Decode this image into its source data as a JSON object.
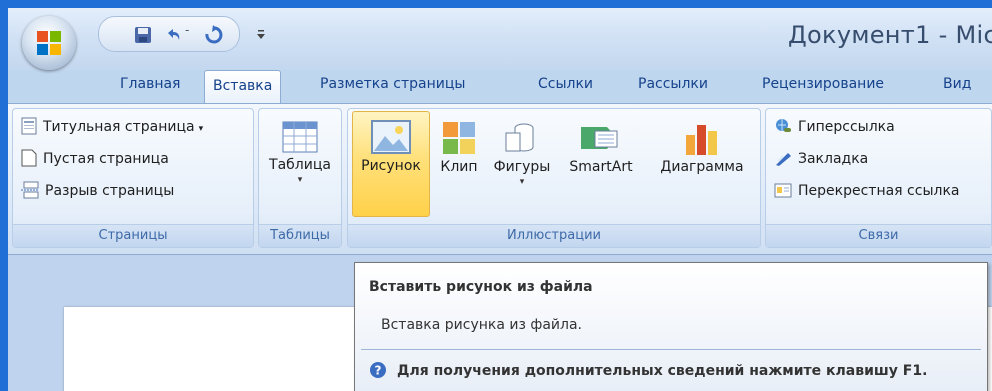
{
  "title_bar": {
    "document_title": "Документ1 - Mic",
    "office_button": "office-button",
    "quick_access": [
      "save-icon",
      "undo-icon",
      "redo-icon"
    ],
    "customize_icon": "customize-qat-icon"
  },
  "tabs": [
    {
      "label": "Главная",
      "active": false
    },
    {
      "label": "Вставка",
      "active": true
    },
    {
      "label": "Разметка страницы",
      "active": false
    },
    {
      "label": "Ссылки",
      "active": false
    },
    {
      "label": "Рассылки",
      "active": false
    },
    {
      "label": "Рецензирование",
      "active": false
    },
    {
      "label": "Вид",
      "active": false
    }
  ],
  "groups": {
    "pages": {
      "label": "Страницы",
      "items": [
        "Титульная страница",
        "Пустая страница",
        "Разрыв страницы"
      ]
    },
    "tables": {
      "label": "Таблицы",
      "items": [
        "Таблица"
      ]
    },
    "illustrations": {
      "label": "Иллюстрации",
      "items": [
        "Рисунок",
        "Клип",
        "Фигуры",
        "SmartArt",
        "Диаграмма"
      ]
    },
    "links": {
      "label": "Связи",
      "items": [
        "Гиперссылка",
        "Закладка",
        "Перекрестная ссылка"
      ]
    }
  },
  "tooltip": {
    "title": "Вставить рисунок из файла",
    "description": "Вставка рисунка из файла.",
    "help": "Для получения дополнительных сведений нажмите клавишу F1."
  },
  "colors": {
    "frame_blue": "#1f6fd6",
    "ribbon_text": "#15428b",
    "group_label": "#3e6aa8",
    "hover_highlight": "#ffd14a"
  }
}
